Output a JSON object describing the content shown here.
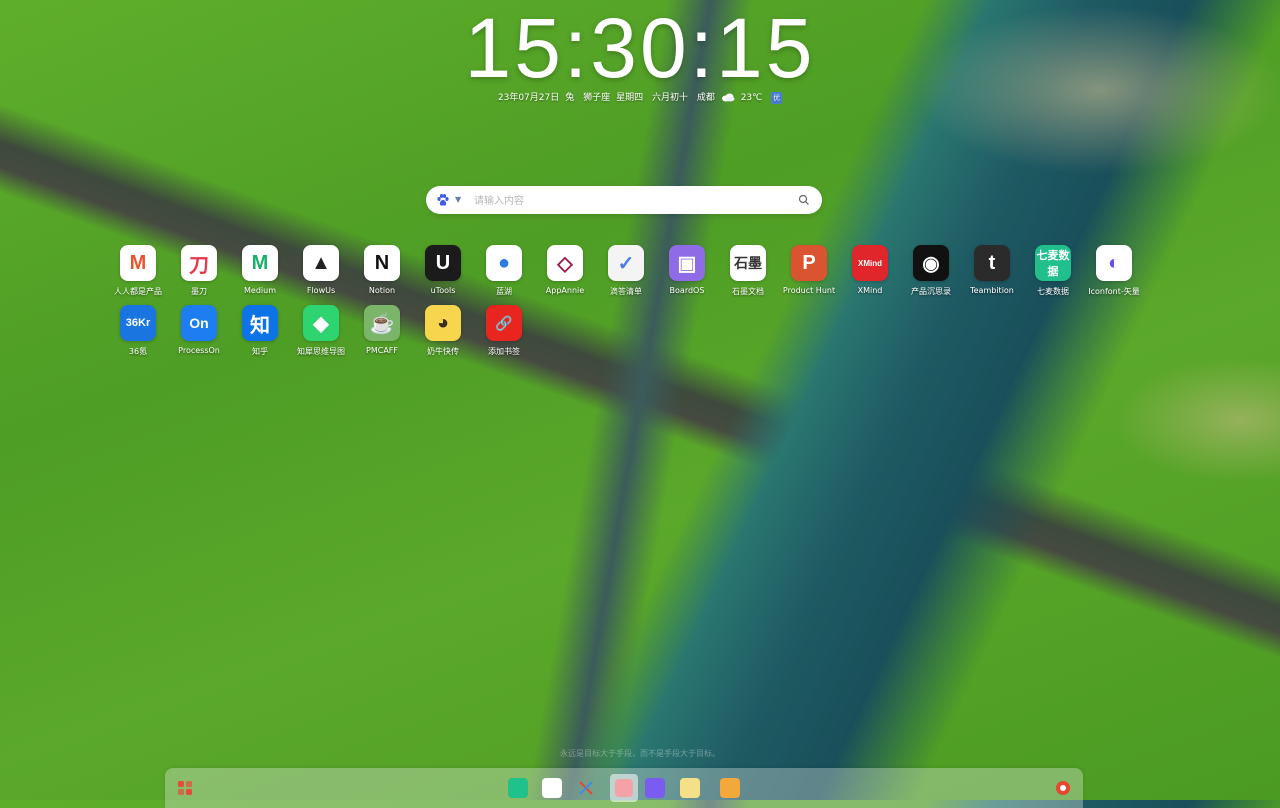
{
  "clock": {
    "time": "15:30:15"
  },
  "date_info": {
    "date": "23年07月27日",
    "zodiac": "兔",
    "constellation": "狮子座",
    "weekday": "星期四",
    "lunar": "六月初十",
    "city": "成都",
    "weather_icon": "cloud-icon",
    "temperature": "23℃",
    "aqi": "优"
  },
  "search": {
    "engine_icon": "baidu-paw-icon",
    "placeholder": "请输入内容",
    "button_icon": "search-icon"
  },
  "apps": [
    {
      "label": "人人都是产品",
      "icon": "m-logo-icon",
      "glyph": "M",
      "bg": "#ffffff",
      "fg": "#e8552d"
    },
    {
      "label": "墨刀",
      "icon": "modao-icon",
      "glyph": "刀",
      "bg": "#ffffff",
      "fg": "#e8374b"
    },
    {
      "label": "Medium",
      "icon": "medium-icon",
      "glyph": "M",
      "bg": "#ffffff",
      "fg": "#1aaf6b"
    },
    {
      "label": "FlowUs",
      "icon": "flowus-icon",
      "glyph": "▲",
      "bg": "#ffffff",
      "fg": "#222222"
    },
    {
      "label": "Notion",
      "icon": "notion-icon",
      "glyph": "N",
      "bg": "#ffffff",
      "fg": "#111111"
    },
    {
      "label": "uTools",
      "icon": "utools-icon",
      "glyph": "U",
      "bg": "#1b1b1b",
      "fg": "#ffffff"
    },
    {
      "label": "蓝湖",
      "icon": "lanhu-icon",
      "glyph": "●",
      "bg": "#ffffff",
      "fg": "#2a7de1"
    },
    {
      "label": "AppAnnie",
      "icon": "diamond-icon",
      "glyph": "◇",
      "bg": "#ffffff",
      "fg": "#9b1b4b"
    },
    {
      "label": "滴答清单",
      "icon": "checkmark-icon",
      "glyph": "✓",
      "bg": "#f4f4f4",
      "fg": "#4b7ee8"
    },
    {
      "label": "BoardOS",
      "icon": "boardos-icon",
      "glyph": "▣",
      "bg": "#8f6be8",
      "fg": "#ffffff"
    },
    {
      "label": "石墨文档",
      "icon": "shimo-icon",
      "glyph": "石墨",
      "bg": "#ffffff",
      "fg": "#333333"
    },
    {
      "label": "Product Hunt",
      "icon": "producthunt-icon",
      "glyph": "P",
      "bg": "#da552f",
      "fg": "#ffffff"
    },
    {
      "label": "XMind",
      "icon": "xmind-icon",
      "glyph": "XMind",
      "bg": "#e0252b",
      "fg": "#ffffff"
    },
    {
      "label": "产品沉思录",
      "icon": "chensilu-icon",
      "glyph": "◉",
      "bg": "#111111",
      "fg": "#ffffff"
    },
    {
      "label": "Teambition",
      "icon": "teambition-icon",
      "glyph": "t",
      "bg": "#2b2b2b",
      "fg": "#ffffff"
    },
    {
      "label": "七麦数据",
      "icon": "qimai-icon",
      "glyph": "七麦数据",
      "bg": "#21bf8c",
      "fg": "#ffffff"
    },
    {
      "label": "Iconfont-矢量",
      "icon": "iconfont-icon",
      "glyph": "◐",
      "bg": "#ffffff",
      "fg": "#6a4be8"
    },
    {
      "label": "36氪",
      "icon": "36kr-icon",
      "glyph": "36Kr",
      "bg": "#1a75e0",
      "fg": "#ffffff"
    },
    {
      "label": "ProcessOn",
      "icon": "processon-icon",
      "glyph": "On",
      "bg": "#1e7df0",
      "fg": "#ffffff"
    },
    {
      "label": "知乎",
      "icon": "zhihu-icon",
      "glyph": "知",
      "bg": "#0d74e8",
      "fg": "#ffffff"
    },
    {
      "label": "知犀思维导图",
      "icon": "rhino-icon",
      "glyph": "◆",
      "bg": "#2ed46f",
      "fg": "#ffffff"
    },
    {
      "label": "PMCAFF",
      "icon": "coffee-cup-icon",
      "glyph": "☕",
      "bg": "#7bb56a",
      "fg": "#ffffff"
    },
    {
      "label": "奶牛快传",
      "icon": "cow-icon",
      "glyph": "◕",
      "bg": "#f7d64e",
      "fg": "#3a2e1a"
    },
    {
      "label": "添加书签",
      "icon": "paperclip-icon",
      "glyph": "🔗",
      "bg": "#e8251e",
      "fg": "#ffffff"
    }
  ],
  "footer": {
    "tagline": "永远是目标大于手段，而不是手段大于目标。"
  },
  "dock": {
    "items": [
      {
        "icon": "app-grid-icon",
        "bg": "#e84b3a"
      },
      {
        "icon": "green-app-icon",
        "bg": "#1fc28a"
      },
      {
        "icon": "calendar-icon",
        "bg": "#ffffff"
      },
      {
        "icon": "tools-icon",
        "bg": "#f2b63c"
      },
      {
        "icon": "active-app-icon",
        "bg": "#f3a3a8"
      },
      {
        "icon": "game-controller-icon",
        "bg": "#7a5cf0"
      },
      {
        "icon": "chat-icon",
        "bg": "#f5e08a"
      },
      {
        "icon": "notes-icon",
        "bg": "#f2a83a"
      },
      {
        "icon": "settings-icon",
        "bg": "#e8472f"
      }
    ]
  }
}
